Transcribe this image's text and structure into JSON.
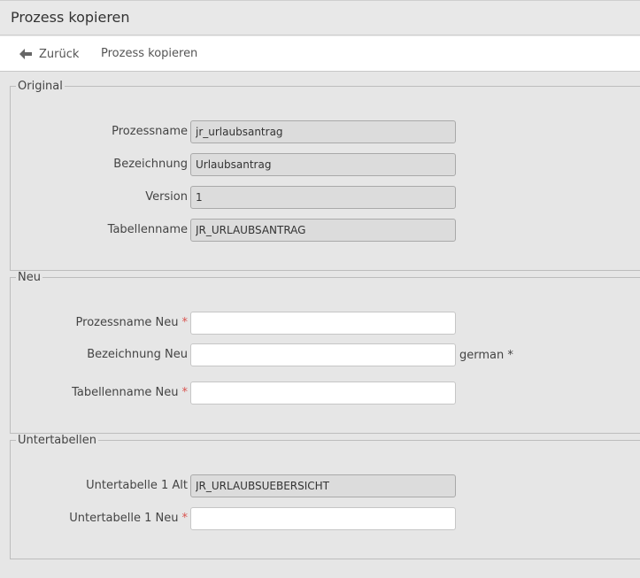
{
  "header": {
    "title": "Prozess kopieren"
  },
  "nav": {
    "back_label": "Zurück",
    "current": "Prozess kopieren"
  },
  "original": {
    "legend": "Original",
    "fields": [
      {
        "label": "Prozessname",
        "value": "jr_urlaubsantrag"
      },
      {
        "label": "Bezeichnung",
        "value": "Urlaubsantrag"
      },
      {
        "label": "Version",
        "value": "1"
      },
      {
        "label": "Tabellenname",
        "value": "JR_URLAUBSANTRAG"
      }
    ]
  },
  "neu": {
    "legend": "Neu",
    "fields": [
      {
        "label": "Prozessname Neu",
        "required": "*",
        "value": ""
      },
      {
        "label": "Bezeichnung Neu",
        "value": "",
        "suffix": "german *"
      },
      {
        "label": "Tabellenname Neu",
        "required": "*",
        "value": ""
      }
    ]
  },
  "untertabellen": {
    "legend": "Untertabellen",
    "fields": [
      {
        "label": "Untertabelle 1 Alt",
        "value": "JR_URLAUBSUEBERSICHT"
      },
      {
        "label": "Untertabelle 1 Neu",
        "required": "*",
        "value": ""
      }
    ]
  }
}
